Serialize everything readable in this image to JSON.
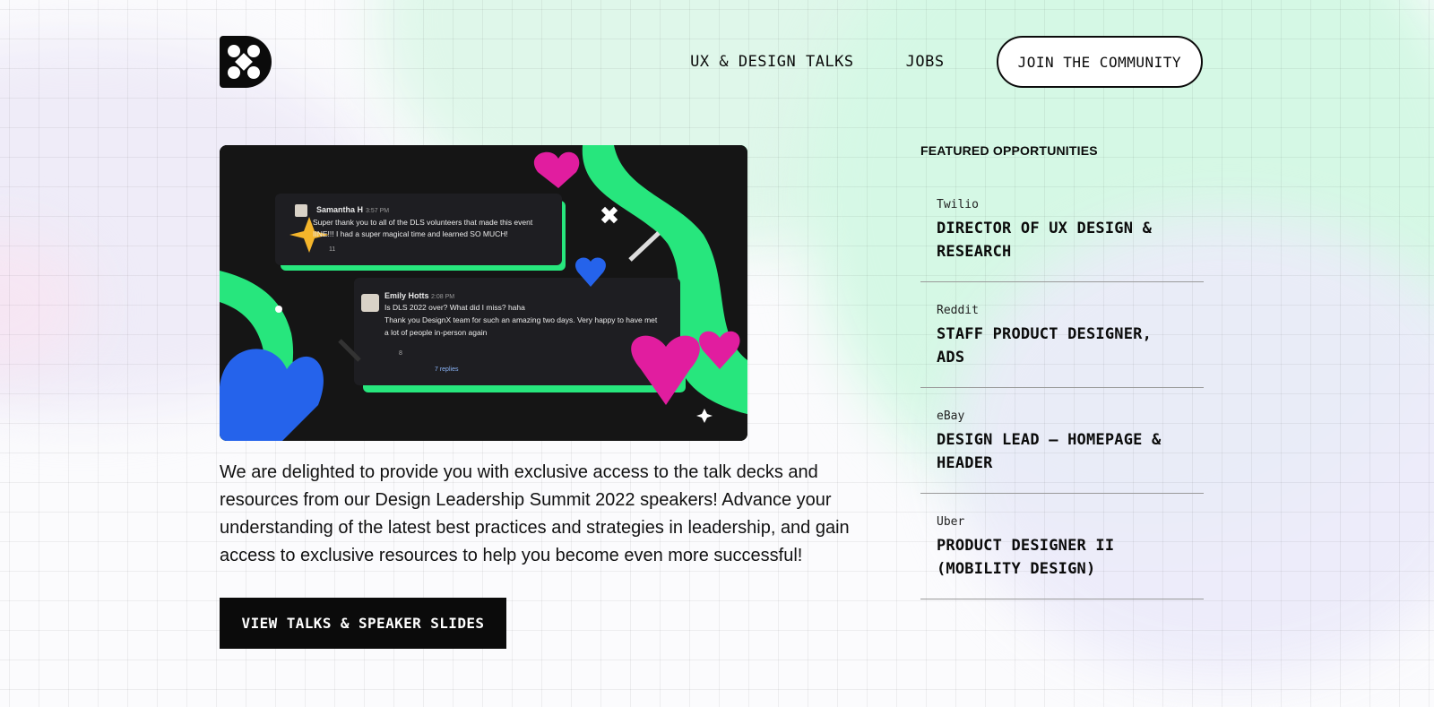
{
  "header": {
    "logo_icon": "designx-logo-icon",
    "nav": [
      {
        "label": "UX & DESIGN TALKS"
      },
      {
        "label": "JOBS"
      }
    ],
    "join_label": "JOIN THE COMMUNITY"
  },
  "hero": {
    "messages": [
      {
        "name": "Samantha H",
        "time": "3:57 PM",
        "text1": "Super thank you to  all of the DLS volunteers that made this event",
        "text2": "IINE!!! I had a super magical time and learned SO MUCH!",
        "reactions": "11"
      },
      {
        "name": "Emily Hotts",
        "time": "2:08 PM",
        "text1": "Is DLS 2022 over? What did I miss? haha",
        "text2": "Thank you DesignX team for such an amazing two days. Very happy to have met",
        "text3": "a lot of people in-person again",
        "reactions": "8",
        "replies": "7 replies"
      }
    ]
  },
  "intro": {
    "text": "We are delighted to provide you with exclusive access to the talk  decks and resources from our Design Leadership Summit 2022 speakers! Advance your understanding of the latest best practices and strategies in leadership, and gain access to exclusive resources to help you become even more successful!"
  },
  "cta": {
    "label": "VIEW TALKS & SPEAKER SLIDES"
  },
  "featured": {
    "title": "FEATURED OPPORTUNITIES",
    "jobs": [
      {
        "company": "Twilio",
        "title": "DIRECTOR OF UX DESIGN & RESEARCH"
      },
      {
        "company": "Reddit",
        "title": "STAFF PRODUCT DESIGNER, ADS"
      },
      {
        "company": "eBay",
        "title": "DESIGN LEAD – HOMEPAGE & HEADER"
      },
      {
        "company": "Uber",
        "title": "PRODUCT DESIGNER II (MOBILITY DESIGN)"
      }
    ]
  },
  "colors": {
    "accent_green": "#27e67d",
    "dark": "#0b0b0b",
    "heart_pink": "#e11d9f",
    "heart_blue": "#2563eb"
  }
}
